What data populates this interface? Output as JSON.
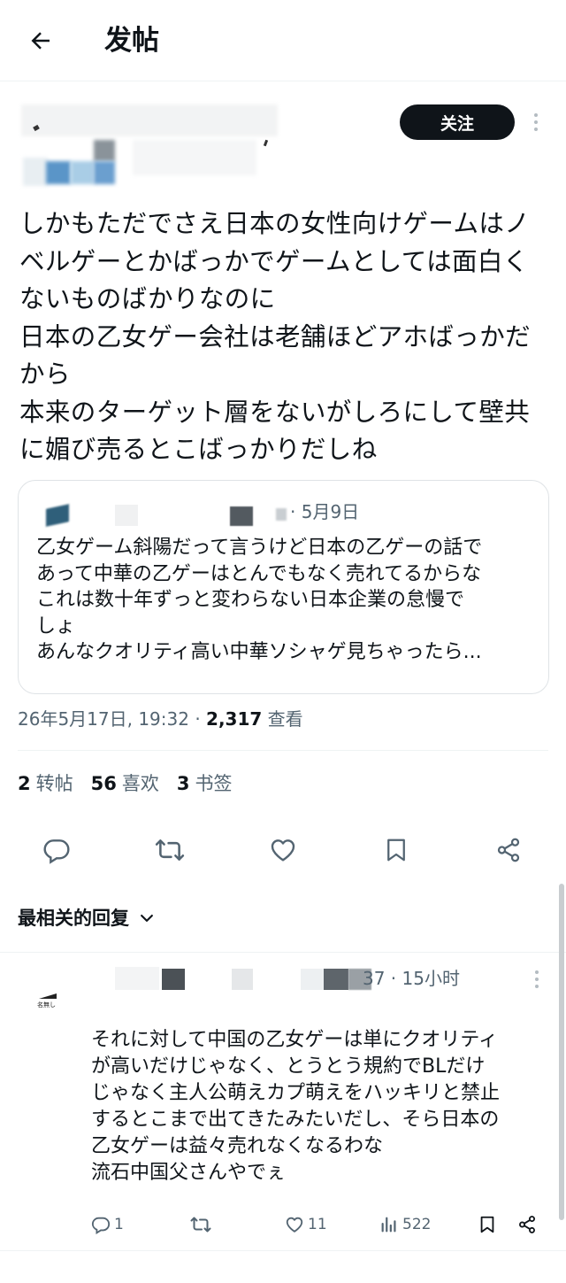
{
  "header": {
    "title": "发帖",
    "back_icon": "arrow-left-icon"
  },
  "post": {
    "follow_label": "关注",
    "text": "しかもただでさえ日本の女性向けゲームはノ\nベルゲーとかばっかでゲームとしては面白く\nないものばかりなのに\n日本の乙女ゲー会社は老舗ほどアホばっかだ\nから\n本来のターゲット層をないがしろにして壁共\nに媚び売るとこばっかりだしね",
    "quote": {
      "date": "· 5月9日",
      "text": "乙女ゲーム斜陽だって言うけど日本の乙ゲーの話で\nあって中華の乙ゲーはとんでもなく売れてるからな\nこれは数十年ずっと変わらない日本企業の怠慢で\nしょ\nあんなクオリティ高い中華ソシャゲ見ちゃったら..."
    },
    "timestamp": "26年5月17日, 19:32 · ",
    "views_count": "2,317",
    "views_label": " 查看",
    "stats": {
      "reposts_count": "2",
      "reposts_label": "转帖",
      "likes_count": "56",
      "likes_label": "喜欢",
      "bookmarks_count": "3",
      "bookmarks_label": "书签"
    }
  },
  "replies_sort": {
    "label": "最相关的回复"
  },
  "reply": {
    "meta": "37 · 15小时",
    "avatar_text": "名無し",
    "text": "それに対して中国の乙女ゲーは単にクオリティ\nが高いだけじゃなく、とうとう規約でBLだけ\nじゃなく主人公萌えカプ萌えをハッキリと禁止\nするとこまで出てきたみたいだし、そら日本の\n乙女ゲーは益々売れなくなるわな\n流石中国父さんやでぇ",
    "replies_count": "1",
    "likes_count": "11",
    "views_count": "522"
  },
  "colors": {
    "text": "#0f1419",
    "secondary": "#536471",
    "divider": "#eff3f4",
    "follow_bg": "#0f1419"
  }
}
